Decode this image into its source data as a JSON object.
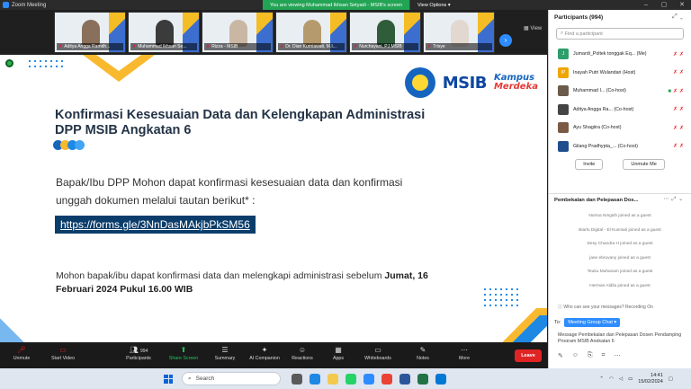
{
  "window": {
    "title": "Zoom Meeting",
    "viewing_banner": "You are viewing Muhammad Ikhsan Setyadi - MSIB's screen",
    "view_options": "View Options"
  },
  "gallery": {
    "tiles": [
      {
        "name": "Aditya Angga Ramdh..."
      },
      {
        "name": "Muhammad Ikhsan Se..."
      },
      {
        "name": "Rizza - MSIB"
      },
      {
        "name": "Dr. Dian Kurniawati, M.I..."
      },
      {
        "name": "Nurchayani, PJ MSIB"
      },
      {
        "name": "Trisye"
      }
    ],
    "view_label": "View"
  },
  "slide": {
    "title": "Konfirmasi Kesesuaian Data dan Kelengkapan Administrasi DPP MSIB Angkatan 6",
    "logo_msib": "MSIB",
    "logo_kampus_1": "Kampus",
    "logo_kampus_2": "Merdeka",
    "text1": "Bapak/Ibu DPP Mohon dapat konfirmasi kesesuaian data dan konfirmasi unggah dokumen melalui tautan berikut* :",
    "link": "https://forms.gle/3NnDasMAkjbPkSM56",
    "text2_a": "Mohon bapak/ibu dapat konfirmasi data dan melengkapi administrasi sebelum ",
    "text2_b": "Jumat, 16 Februari 2024 Pukul 16.00 WIB"
  },
  "participants": {
    "header": "Participants (994)",
    "search_placeholder": "Find a participant",
    "rows": [
      {
        "initials": "J",
        "color": "#2e9e6a",
        "name": "Jumardi_Poltek tonggak Eq... (Me)"
      },
      {
        "initials": "IP",
        "color": "#f0a500",
        "name": "Inayah Putri Wulandari (Host)"
      },
      {
        "initials": "",
        "color": "#6b5b4b",
        "name": "Muhammad I... (Co-host)"
      },
      {
        "initials": "",
        "color": "#444",
        "name": "Aditya Angga Ra... (Co-host)"
      },
      {
        "initials": "",
        "color": "#7a5a44",
        "name": "Ayu Shagiira (Co-host)"
      },
      {
        "initials": "",
        "color": "#1f4e8c",
        "name": "Gilang Pradhypta_... (Co-host)"
      }
    ],
    "invite_label": "Invite",
    "unmute_label": "Unmute Me"
  },
  "chat": {
    "header": "Pembekalan dan Pelepasan Dos...",
    "messages": [
      "Norma Ningsih joined as a guest",
      "Biarlu Digital - El Kusniati joined as a guest",
      "Desy Chandra H joined as a guest",
      "jane ebruvany joined as a guest",
      "Teuku Muhazam joined as a guest",
      "Herman Aldila joined as a guest"
    ],
    "note": "Who can see your messages? Recording On",
    "to_label": "To:",
    "to_value": "Meeting Group Chat",
    "input_value": "Message Pembekalan dan Pelepasan Dosen Pendamping Program MSIB Angkatan 6"
  },
  "toolbar": {
    "unmute": "Unmute",
    "start_video": "Start Video",
    "participants": "Participants",
    "participants_count": "994",
    "share_screen": "Share Screen",
    "summary": "Summary",
    "ai_companion": "AI Companion",
    "reactions": "Reactions",
    "apps": "Apps",
    "whiteboards": "Whiteboards",
    "notes": "Notes",
    "more": "More",
    "leave": "Leave"
  },
  "taskbar": {
    "search_placeholder": "Search",
    "time": "14:41",
    "date": "15/02/2024"
  }
}
